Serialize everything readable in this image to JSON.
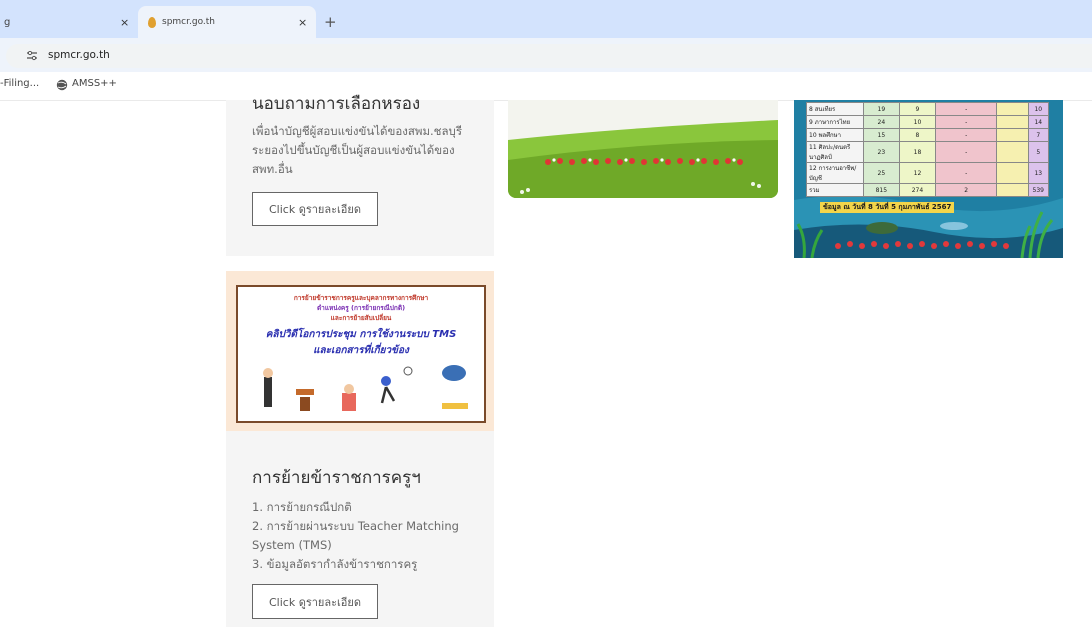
{
  "browser": {
    "tabs": [
      {
        "label": "g",
        "active": false
      },
      {
        "label": "spmcr.go.th",
        "active": true
      }
    ],
    "close_glyph": "×",
    "new_tab_glyph": "+",
    "address": "spmcr.go.th",
    "bookmarks": [
      {
        "label": "-Filing..."
      },
      {
        "label": "AMSS++"
      }
    ]
  },
  "card1": {
    "heading_partial": "นอบถามการเลือกหรอง",
    "description": "เพื่อนำบัญชีผู้สอบแข่งขันได้ของสพม.ชลบุรี ระยองไปขึ้นบัญชีเป็นผู้สอบแข่งขันได้ของ สพท.อื่น",
    "button_label": "Click ดูรายละเอียด"
  },
  "banner": {
    "line1": "การย้ายข้าราชการครูและบุคลากรทางการศึกษา",
    "line2": "ตำแหน่งครู (การย้ายกรณีปกติ)",
    "line3": "และการย้ายสับเปลี่ยน",
    "line4": "คลิปวิดีโอการประชุม การใช้งานระบบ TMS",
    "line5": "และเอกสารที่เกี่ยวข้อง"
  },
  "card2": {
    "title": "การย้ายข้าราชการครูฯ",
    "items": [
      "1. การย้ายกรณีปกติ",
      "2. การย้ายผ่านระบบ Teacher Matching System (TMS)",
      "3. ข้อมูลอัตรากำลังข้าราชการครู"
    ],
    "button_label": "Click ดูรายละเอียด"
  },
  "chart_image": {
    "rows": [
      {
        "no": "8",
        "name": "สนเทียร",
        "a": "19",
        "b": "9",
        "c": "-",
        "d": "",
        "e": "10"
      },
      {
        "no": "9",
        "name": "ภาษาการไทย",
        "a": "24",
        "b": "10",
        "c": "-",
        "d": "",
        "e": "14"
      },
      {
        "no": "10",
        "name": "พลศึกษา",
        "a": "15",
        "b": "8",
        "c": "-",
        "d": "",
        "e": "7"
      },
      {
        "no": "11",
        "name": "ศิลปะ/ดนตรีนาฏศิลป์",
        "a": "23",
        "b": "18",
        "c": "-",
        "d": "",
        "e": "5"
      },
      {
        "no": "12",
        "name": "การงานอาชีพ/บัญชี",
        "a": "25",
        "b": "12",
        "c": "-",
        "d": "",
        "e": "13"
      }
    ],
    "total": {
      "label": "รวม",
      "a": "815",
      "b": "274",
      "c": "2",
      "d": "",
      "e": "539"
    },
    "caption": "ข้อมูล ณ วันที่ 8 วันที่ 5 กุมภาพันธ์ 2567"
  },
  "colors": {
    "tabstrip": "#d3e3fd",
    "card_bg": "#f5f5f5",
    "hill_green": "#7cb932",
    "chart_water": "#1b6d8c"
  }
}
